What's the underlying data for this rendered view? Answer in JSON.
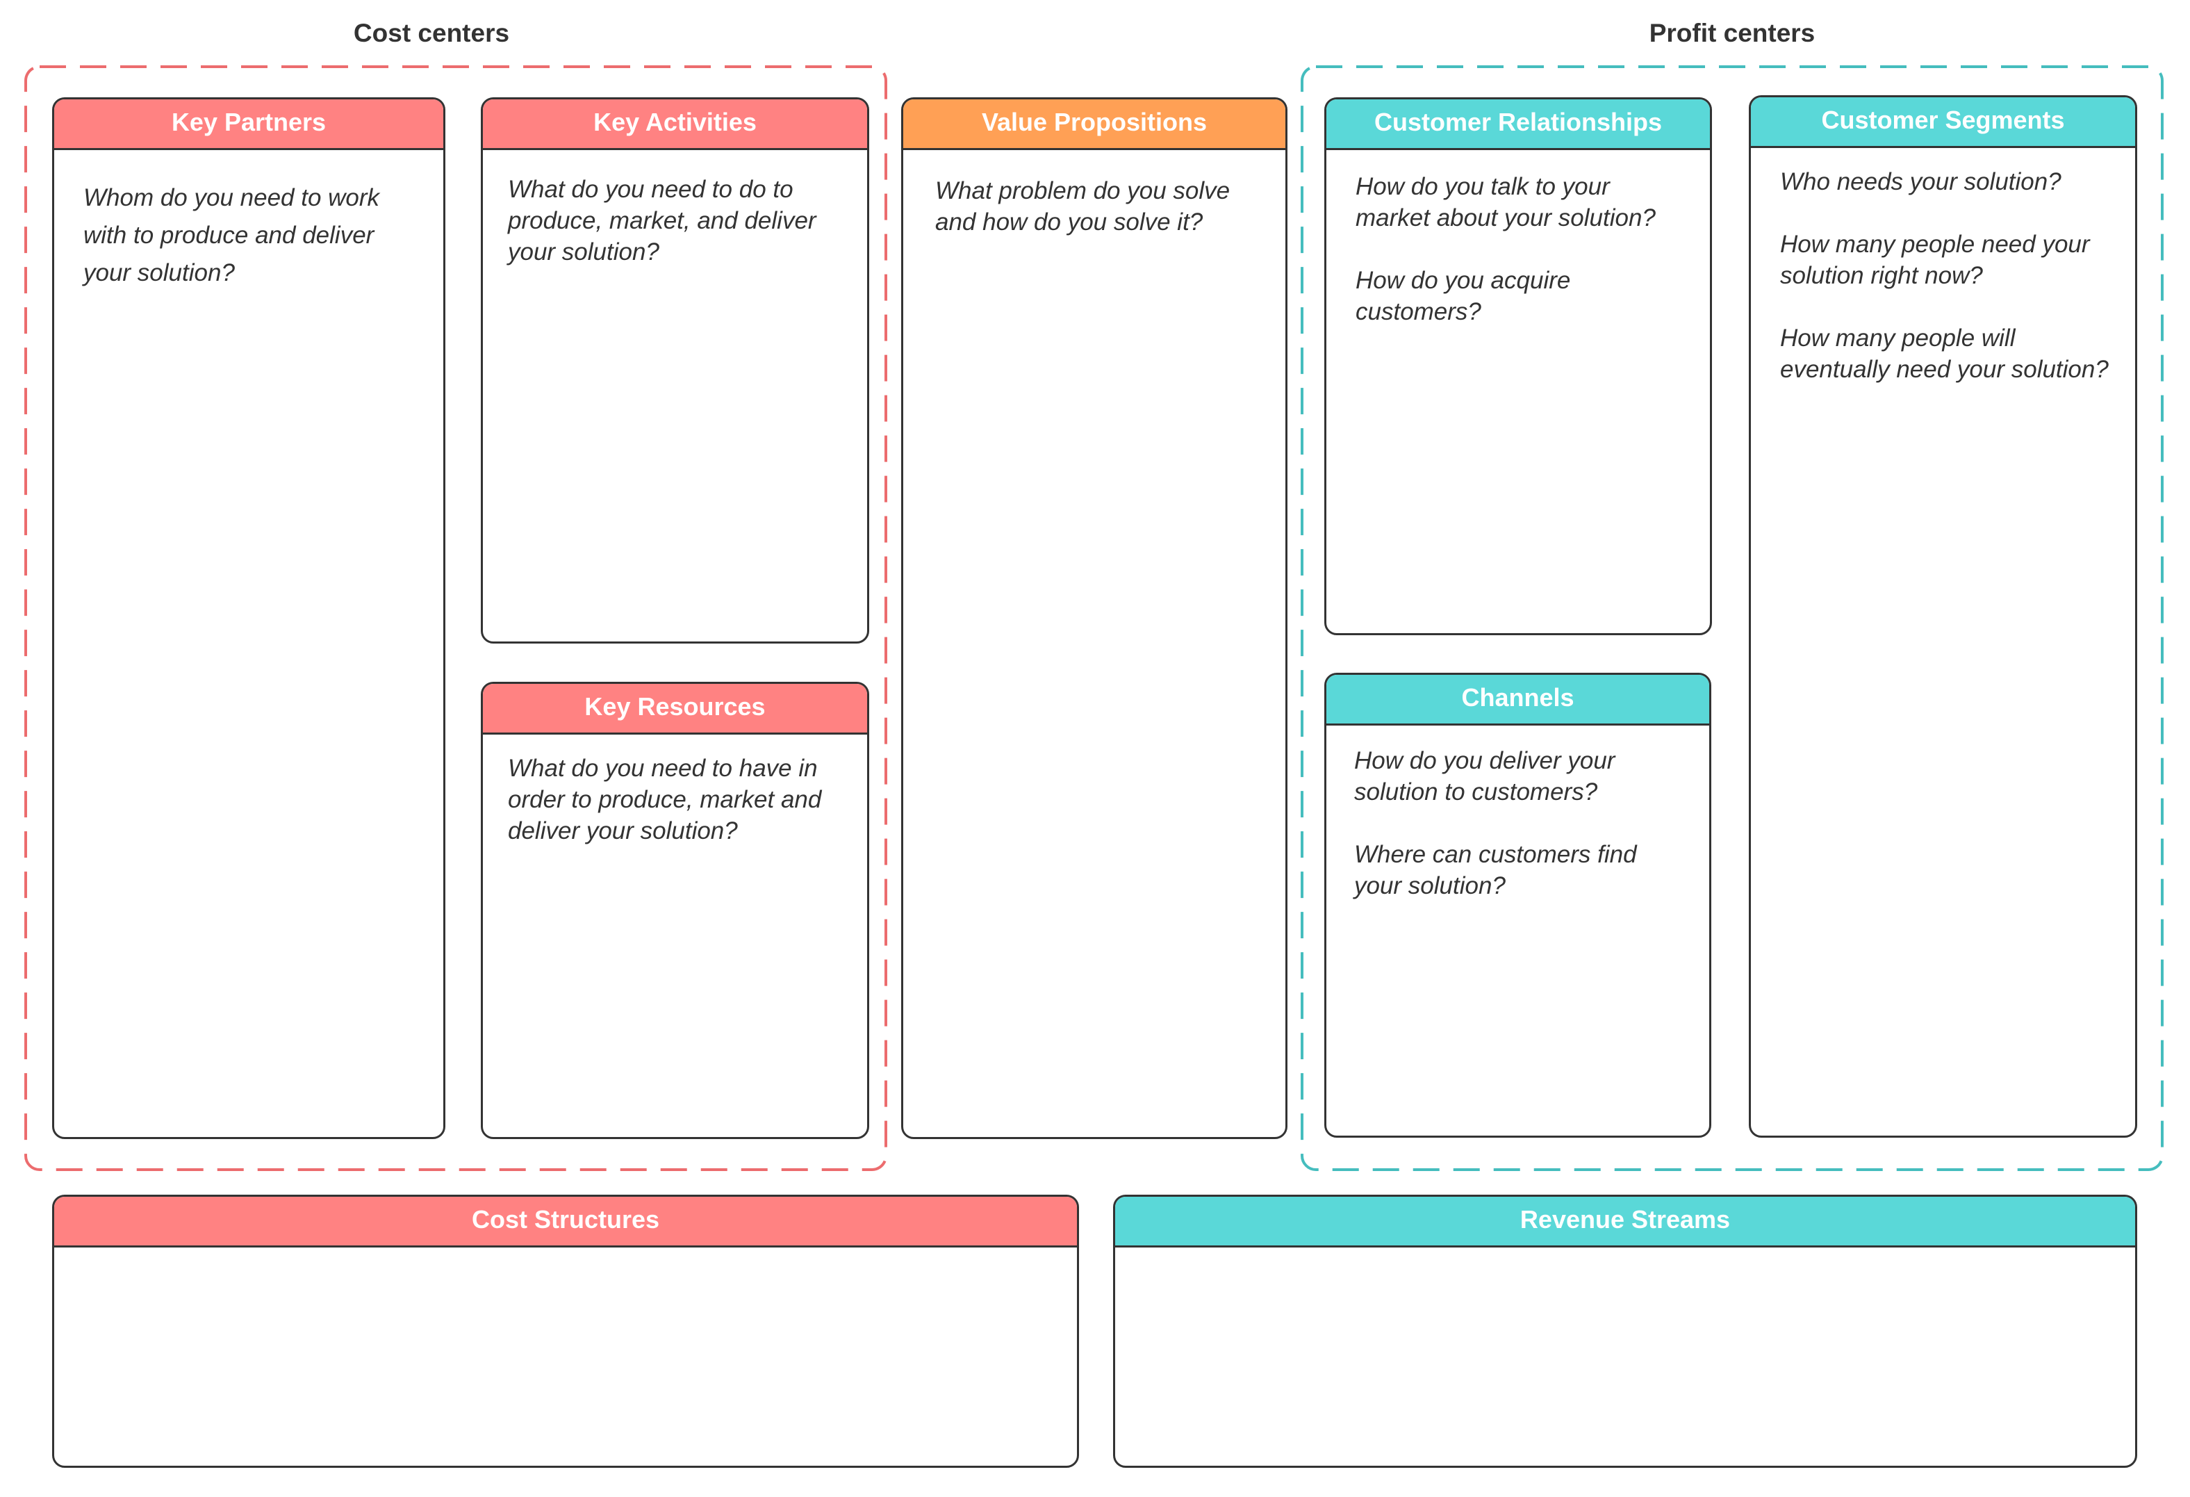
{
  "colors": {
    "cost": "#FF8282",
    "value": "#FFA055",
    "profit": "#5AD8D8",
    "cost_dash": "#EC6C6E",
    "profit_dash": "#45BDBE"
  },
  "groups": {
    "cost_centers": {
      "title": "Cost centers"
    },
    "profit_centers": {
      "title": "Profit centers"
    }
  },
  "cards": {
    "key_partners": {
      "title": "Key Partners",
      "questions": [
        "Whom do you need to work with to produce and deliver your solution?"
      ]
    },
    "key_activities": {
      "title": "Key Activities",
      "questions": [
        "What do you need to do to produce, market, and deliver your solution?"
      ]
    },
    "key_resources": {
      "title": "Key Resources",
      "questions": [
        "What do you need to have in order to produce, market and deliver your solution?"
      ]
    },
    "value_propositions": {
      "title": "Value Propositions",
      "questions": [
        "What problem do you solve and how do you solve it?"
      ]
    },
    "customer_relationships": {
      "title": "Customer Relationships",
      "questions": [
        "How do you talk to your market about your solution?",
        "How do you acquire customers?"
      ]
    },
    "channels": {
      "title": "Channels",
      "questions": [
        "How do you deliver your solution to customers?",
        "Where can customers find your solution?"
      ]
    },
    "customer_segments": {
      "title": "Customer Segments",
      "questions": [
        "Who needs your solution?",
        "How many people need your solution right now?",
        "How many people will eventually need your solution?"
      ]
    },
    "cost_structures": {
      "title": "Cost Structures",
      "questions": []
    },
    "revenue_streams": {
      "title": "Revenue Streams",
      "questions": []
    }
  }
}
